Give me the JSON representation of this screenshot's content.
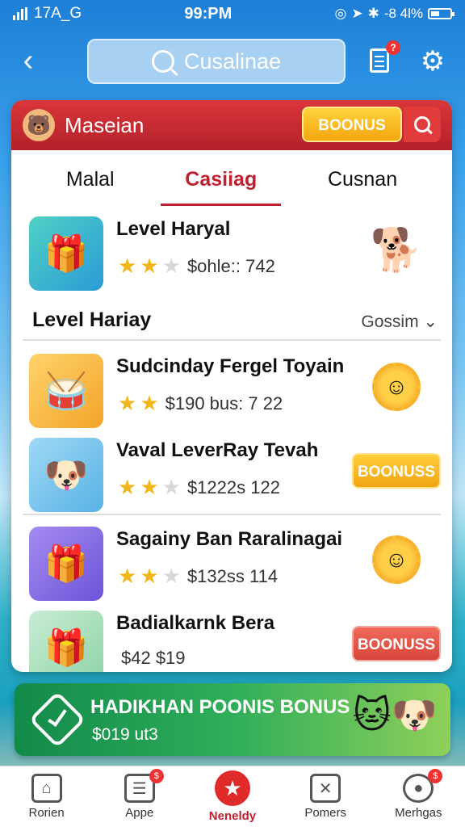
{
  "status_bar": {
    "carrier": "17A_G",
    "time": "99:PM",
    "battery_text": "-8 4l%"
  },
  "top_nav": {
    "search_placeholder": "Cusalinae",
    "notification_badge": "?"
  },
  "card": {
    "header_title": "Maseian",
    "header_bonus_label": "BOONUS",
    "tabs": [
      {
        "label": "Malal",
        "active": false
      },
      {
        "label": "Casiiag",
        "active": true
      },
      {
        "label": "Cusnan",
        "active": false
      }
    ],
    "featured": {
      "title": "Level Haryal",
      "meta": "$ohle:: 742",
      "stars": 2
    },
    "section": {
      "title": "Level Hariay",
      "sort_label": "Gossim ⌄"
    },
    "items": [
      {
        "title": "Sudcinday Fergel Toyain",
        "meta": "$190 bus: 7 22",
        "stars": 2,
        "action": "medal"
      },
      {
        "title": "Vaval LeverRay Tevah",
        "meta": "$1222s 122",
        "stars": 2,
        "action": "button",
        "button_label": "BOONUSS"
      },
      {
        "title": "Sagainy Ban Raralinagai",
        "meta": "$132ss 114",
        "stars": 2,
        "action": "medal"
      },
      {
        "title": "Badialkarnk Bera",
        "meta": "$42 $19",
        "stars": 0,
        "action": "button",
        "button_label": "BOONUSS"
      }
    ]
  },
  "promo": {
    "title": "HADIKHAN POONIS BONUS",
    "subtitle": "$019 ut3"
  },
  "bottom_nav": [
    {
      "label": "Rorien",
      "icon": "home-icon",
      "active": false
    },
    {
      "label": "Appe",
      "icon": "apps-icon",
      "active": false,
      "badge": "$"
    },
    {
      "label": "Neneldy",
      "icon": "star-icon",
      "active": true
    },
    {
      "label": "Pomers",
      "icon": "close-box-icon",
      "active": false
    },
    {
      "label": "Merhgas",
      "icon": "record-icon",
      "active": false,
      "badge": "$"
    }
  ],
  "colors": {
    "accent_red": "#c02030",
    "bonus_yellow": "#f4a50f",
    "bonus_red": "#d7453c",
    "promo_green": "#2fae5a"
  }
}
